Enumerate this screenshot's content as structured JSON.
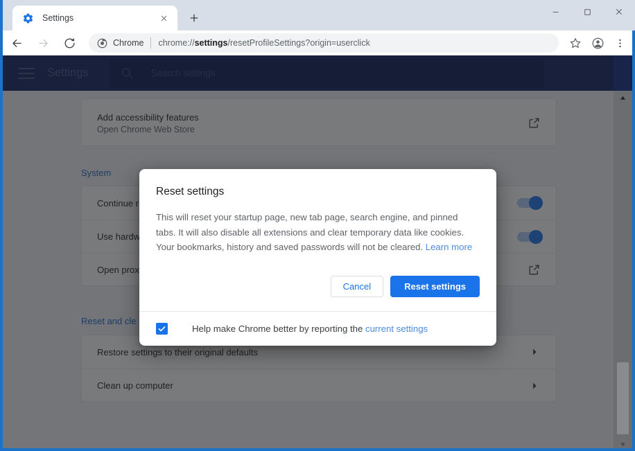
{
  "window": {
    "controls": {
      "minimize": "minimize-button",
      "maximize": "maximize-button",
      "close": "close-button"
    }
  },
  "tabs": [
    {
      "title": "Settings",
      "favicon": "settings-gear-icon",
      "active": true
    }
  ],
  "newtab_label": "+",
  "toolbar": {
    "back": "back-arrow",
    "forward": "forward-arrow",
    "reload": "reload-arrow",
    "omnibox": {
      "chip_label": "Chrome",
      "url_prefix": "chrome://",
      "url_bold": "settings",
      "url_suffix": "/resetProfileSettings?origin=userclick",
      "full_url": "chrome://settings/resetProfileSettings?origin=userclick"
    },
    "bookmark": "star-icon",
    "profile": "profile-avatar-icon",
    "menu": "three-dot-menu-icon"
  },
  "settings_header": {
    "menu_button": "hamburger-icon",
    "title": "Settings",
    "search_placeholder": "Search settings",
    "search_value": ""
  },
  "page": {
    "accessibility_card": {
      "title": "Add accessibility features",
      "subtitle": "Open Chrome Web Store",
      "action_icon": "external-link-icon"
    },
    "system_section": {
      "title": "System",
      "rows": [
        {
          "label": "Continue ru",
          "control": "toggle",
          "on": true
        },
        {
          "label": "Use hardwa",
          "control": "toggle",
          "on": true
        },
        {
          "label": "Open proxy",
          "control": "external-link-icon"
        }
      ]
    },
    "reset_section": {
      "title": "Reset and cle",
      "rows": [
        {
          "label": "Restore settings to their original defaults",
          "control": "chevron-right-icon"
        },
        {
          "label": "Clean up computer",
          "control": "chevron-right-icon"
        }
      ]
    }
  },
  "dialog": {
    "title": "Reset settings",
    "body_text": "This will reset your startup page, new tab page, search engine, and pinned tabs. It will also disable all extensions and clear temporary data like cookies. Your bookmarks, history and saved passwords will not be cleared.",
    "learn_more_label": "Learn more",
    "cancel_label": "Cancel",
    "confirm_label": "Reset settings",
    "checkbox": {
      "checked": true,
      "label_prefix": "Help make Chrome better by reporting the",
      "link_label": "current settings"
    }
  },
  "colors": {
    "accent_blue": "#1a73e8",
    "link_blue": "#4e8be0",
    "header_navy": "#1f2f5c",
    "scrim": "rgba(32,33,36,0.60)"
  },
  "scrollbar": {
    "up_arrow": "scroll-up-arrow",
    "down_arrow": "scroll-down-arrow"
  }
}
